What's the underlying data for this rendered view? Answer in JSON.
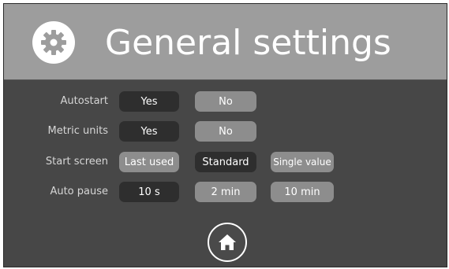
{
  "header": {
    "title": "General settings",
    "icon": "gear-icon"
  },
  "rows": [
    {
      "label": "Autostart",
      "options": [
        "Yes",
        "No"
      ],
      "selected": "Yes"
    },
    {
      "label": "Metric units",
      "options": [
        "Yes",
        "No"
      ],
      "selected": "Yes"
    },
    {
      "label": "Start screen",
      "options": [
        "Last used",
        "Standard",
        "Single value"
      ],
      "selected": "Standard"
    },
    {
      "label": "Auto pause",
      "options": [
        "10 s",
        "2 min",
        "10 min"
      ],
      "selected": "10 s"
    }
  ],
  "footer": {
    "icon": "home-icon"
  },
  "colors": {
    "header_bg": "#9d9d9d",
    "screen_bg": "#474747",
    "selected_bg": "#2e2e2e",
    "unselected_bg": "#8d8d8d"
  }
}
